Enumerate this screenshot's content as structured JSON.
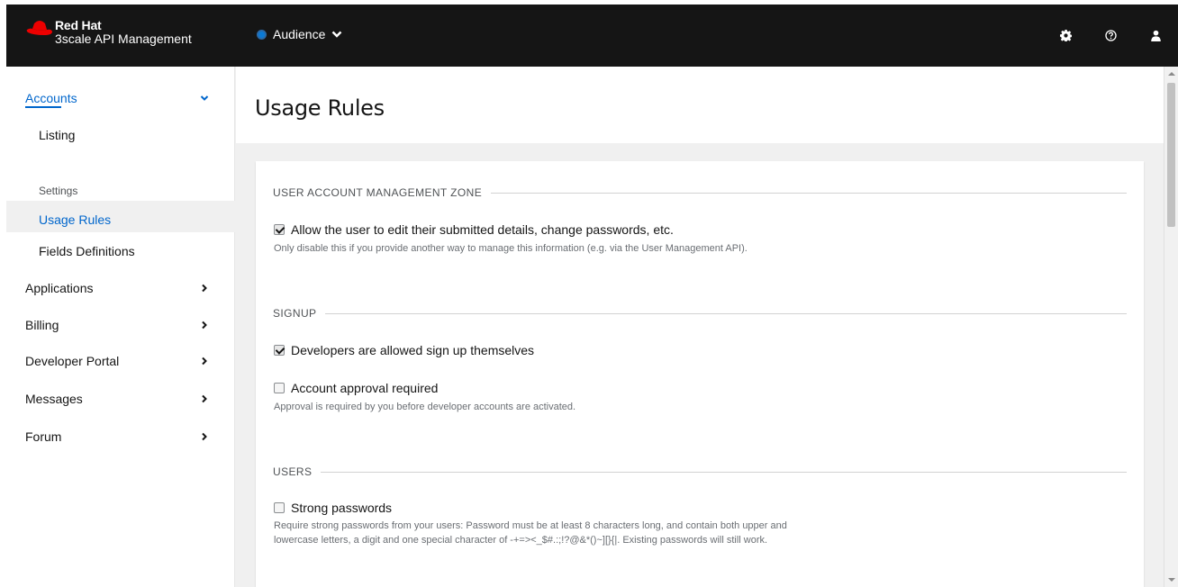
{
  "masthead": {
    "brand_top": "Red Hat",
    "brand_bottom": "3scale API Management",
    "context_label": "Audience",
    "icons": [
      "settings-icon",
      "help-icon",
      "user-icon"
    ]
  },
  "sidebar": {
    "accounts": {
      "label": "Accounts",
      "listing": "Listing",
      "settings_label": "Settings",
      "usage_rules": "Usage Rules",
      "fields_definitions": "Fields Definitions"
    },
    "items": [
      {
        "label": "Applications"
      },
      {
        "label": "Billing"
      },
      {
        "label": "Developer Portal"
      },
      {
        "label": "Messages"
      },
      {
        "label": "Forum"
      }
    ]
  },
  "page": {
    "title": "Usage Rules"
  },
  "form": {
    "sections": [
      {
        "legend": "USER ACCOUNT MANAGEMENT ZONE",
        "options": [
          {
            "label": "Allow the user to edit their submitted details, change passwords, etc.",
            "checked": true,
            "help": "Only disable this if you provide another way to manage this information (e.g. via the User Management API)."
          }
        ]
      },
      {
        "legend": "SIGNUP",
        "options": [
          {
            "label": "Developers are allowed sign up themselves",
            "checked": true,
            "help": ""
          },
          {
            "label": "Account approval required",
            "checked": false,
            "help": "Approval is required by you before developer accounts are activated."
          }
        ]
      },
      {
        "legend": "USERS",
        "options": [
          {
            "label": "Strong passwords",
            "checked": false,
            "help_line1": "Require strong passwords from your users: Password must be at least 8 characters long, and contain both upper and",
            "help_line2": "lowercase letters, a digit and one special character of -+=><_$#.:;!?@&*()~][}{|. Existing passwords will still work."
          }
        ]
      }
    ]
  },
  "colors": {
    "masthead_bg": "#151515",
    "accent": "#0066cc",
    "brand_red": "#ee0000"
  }
}
